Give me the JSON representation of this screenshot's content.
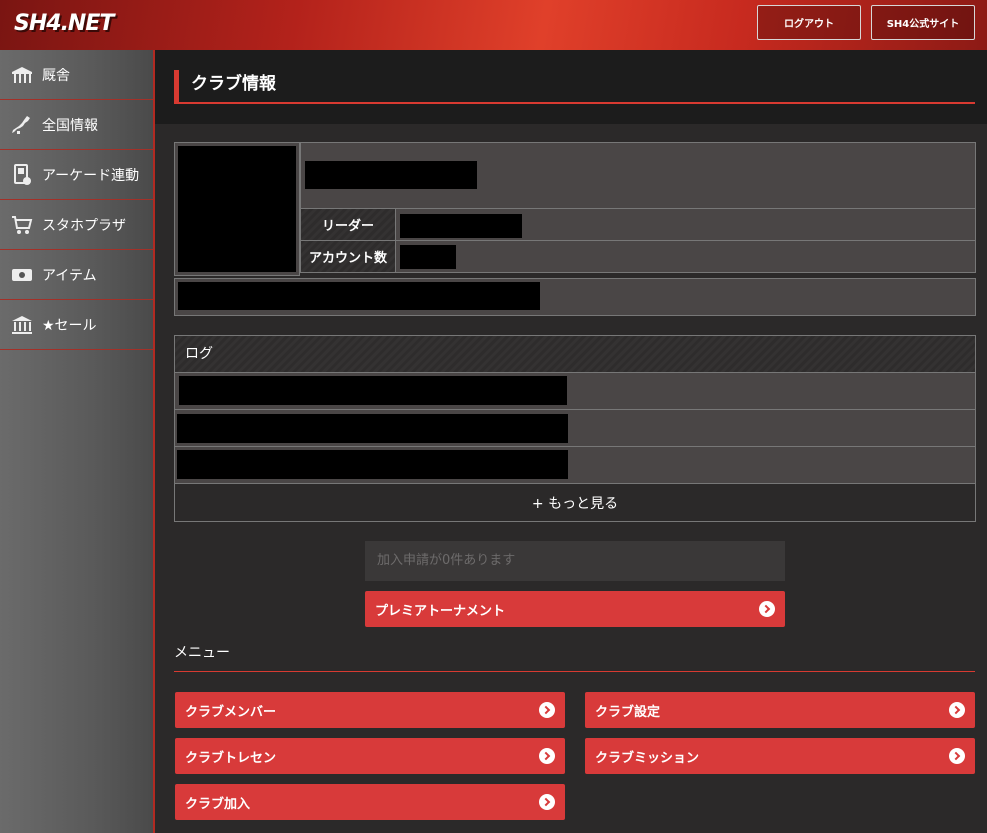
{
  "header": {
    "logo_text": "SH4.NET",
    "logout_label": "ログアウト",
    "official_label": "SH4公式サイト"
  },
  "sidebar": {
    "items": [
      {
        "label": "厩舎",
        "icon": "stable-icon"
      },
      {
        "label": "全国情報",
        "icon": "japan-map-icon"
      },
      {
        "label": "アーケード連動",
        "icon": "arcade-icon"
      },
      {
        "label": "スタホプラザ",
        "icon": "cart-icon"
      },
      {
        "label": "アイテム",
        "icon": "ticket-icon"
      },
      {
        "label": "★セール",
        "icon": "bank-icon"
      }
    ]
  },
  "page": {
    "title": "クラブ情報"
  },
  "club_info": {
    "leader_label": "リーダー",
    "accounts_label": "アカウント数"
  },
  "log": {
    "header": "ログ",
    "more_label": "+ もっと見る"
  },
  "join_status": "加入申請が0件あります",
  "premier_button": "プレミアトーナメント",
  "menu": {
    "title": "メニュー",
    "items": [
      "クラブメンバー",
      "クラブ設定",
      "クラブトレセン",
      "クラブミッション",
      "クラブ加入"
    ]
  },
  "colors": {
    "accent": "#d83a3a",
    "header_red": "#e0402a"
  }
}
